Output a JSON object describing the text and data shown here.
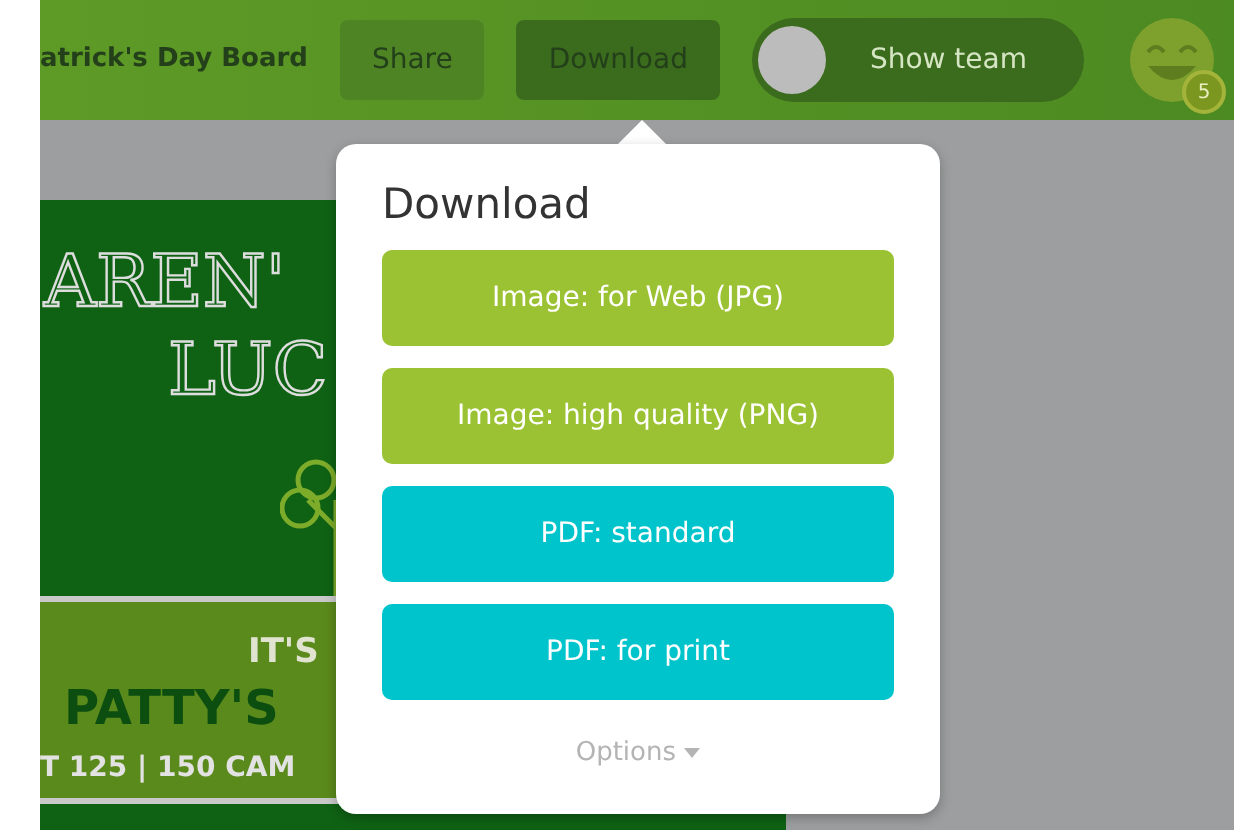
{
  "topbar": {
    "title": "atrick's Day Board",
    "buttons": [
      {
        "label": "Share",
        "selected": false
      },
      {
        "label": "Download",
        "selected": true
      }
    ],
    "toggle": {
      "label": "Show team",
      "on": false
    },
    "avatar": {
      "badge": "5"
    }
  },
  "poster": {
    "headline": [
      "AREN'",
      "LUC"
    ],
    "kicker": "IT'S",
    "title": "PATTY'S",
    "address": "T 125 | 150 CAM"
  },
  "popover": {
    "title": "Download",
    "options": [
      {
        "label": "Image: for Web (JPG)",
        "kind": "image"
      },
      {
        "label": "Image: high quality (PNG)",
        "kind": "image"
      },
      {
        "label": "PDF: standard",
        "kind": "pdf"
      },
      {
        "label": "PDF: for print",
        "kind": "pdf"
      }
    ],
    "more": "Options"
  }
}
